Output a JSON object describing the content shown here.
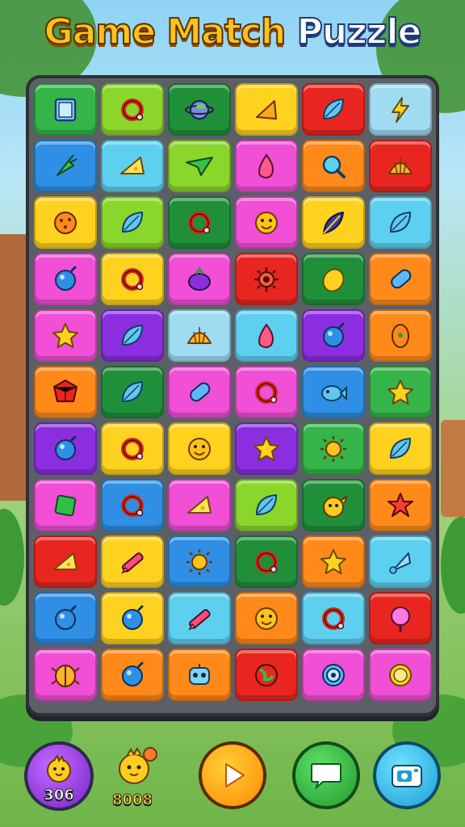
{
  "title": {
    "word1": "Game Match",
    "word2": "Puzzle"
  },
  "colors": {
    "green": "#34b449",
    "lime": "#8bd62a",
    "yellow": "#ffd21f",
    "red": "#e8261f",
    "sky": "#5ed0ef",
    "blue": "#2e8fe4",
    "pink": "#f04fd6",
    "orange": "#ff8a1a",
    "purple": "#8a2ee0",
    "paleblue": "#9fdcf2",
    "darkgreen": "#1f8f3a",
    "magenta": "#ee3fae"
  },
  "board": {
    "rows": [
      [
        {
          "bg": "green",
          "icon": "frame-icon"
        },
        {
          "bg": "lime",
          "icon": "ring-icon"
        },
        {
          "bg": "darkgreen",
          "icon": "planet-icon"
        },
        {
          "bg": "yellow",
          "icon": "wedge-icon"
        },
        {
          "bg": "red",
          "icon": "leaf-icon"
        },
        {
          "bg": "paleblue",
          "icon": "lightning-icon"
        }
      ],
      [
        {
          "bg": "blue",
          "icon": "carrot-icon"
        },
        {
          "bg": "sky",
          "icon": "cheese-icon"
        },
        {
          "bg": "lime",
          "icon": "plane-icon"
        },
        {
          "bg": "pink",
          "icon": "drop-icon"
        },
        {
          "bg": "orange",
          "icon": "magnifier-icon"
        },
        {
          "bg": "red",
          "icon": "shell-icon"
        }
      ],
      [
        {
          "bg": "yellow",
          "icon": "cookie-icon"
        },
        {
          "bg": "lime",
          "icon": "leaf-icon"
        },
        {
          "bg": "darkgreen",
          "icon": "ring-icon"
        },
        {
          "bg": "pink",
          "icon": "smiley-icon"
        },
        {
          "bg": "yellow",
          "icon": "feather-icon"
        },
        {
          "bg": "sky",
          "icon": "leaf-icon"
        }
      ],
      [
        {
          "bg": "pink",
          "icon": "orb-icon"
        },
        {
          "bg": "yellow",
          "icon": "ring-icon"
        },
        {
          "bg": "pink",
          "icon": "berry-icon"
        },
        {
          "bg": "red",
          "icon": "gear-icon"
        },
        {
          "bg": "darkgreen",
          "icon": "lemon-icon"
        },
        {
          "bg": "orange",
          "icon": "capsule-icon"
        }
      ],
      [
        {
          "bg": "pink",
          "icon": "star-icon"
        },
        {
          "bg": "purple",
          "icon": "leaf-icon"
        },
        {
          "bg": "paleblue",
          "icon": "shell-icon"
        },
        {
          "bg": "sky",
          "icon": "drop-icon"
        },
        {
          "bg": "purple",
          "icon": "orb-icon"
        },
        {
          "bg": "orange",
          "icon": "seed-icon"
        }
      ],
      [
        {
          "bg": "orange",
          "icon": "gem-icon"
        },
        {
          "bg": "darkgreen",
          "icon": "leaf-icon"
        },
        {
          "bg": "pink",
          "icon": "capsule-icon"
        },
        {
          "bg": "pink",
          "icon": "ring-icon"
        },
        {
          "bg": "blue",
          "icon": "fish-icon"
        },
        {
          "bg": "green",
          "icon": "star-icon"
        }
      ],
      [
        {
          "bg": "purple",
          "icon": "orb-icon"
        },
        {
          "bg": "yellow",
          "icon": "ring-icon"
        },
        {
          "bg": "yellow",
          "icon": "smiley-icon"
        },
        {
          "bg": "purple",
          "icon": "star-icon"
        },
        {
          "bg": "green",
          "icon": "sun-icon"
        },
        {
          "bg": "yellow",
          "icon": "leaf-icon"
        }
      ],
      [
        {
          "bg": "pink",
          "icon": "cube-icon"
        },
        {
          "bg": "blue",
          "icon": "ring-icon"
        },
        {
          "bg": "pink",
          "icon": "cheese-icon"
        },
        {
          "bg": "lime",
          "icon": "leaf-icon"
        },
        {
          "bg": "darkgreen",
          "icon": "chick-icon"
        },
        {
          "bg": "orange",
          "icon": "flower-icon"
        }
      ],
      [
        {
          "bg": "red",
          "icon": "cheese-icon"
        },
        {
          "bg": "yellow",
          "icon": "pencil-icon"
        },
        {
          "bg": "blue",
          "icon": "sun-icon"
        },
        {
          "bg": "darkgreen",
          "icon": "ring-icon"
        },
        {
          "bg": "orange",
          "icon": "star-icon"
        },
        {
          "bg": "sky",
          "icon": "cone-icon"
        }
      ],
      [
        {
          "bg": "blue",
          "icon": "orb-icon"
        },
        {
          "bg": "yellow",
          "icon": "orb-icon"
        },
        {
          "bg": "sky",
          "icon": "pencil-icon"
        },
        {
          "bg": "orange",
          "icon": "smiley-icon"
        },
        {
          "bg": "sky",
          "icon": "ring-icon"
        },
        {
          "bg": "red",
          "icon": "lollipop-icon"
        }
      ],
      [
        {
          "bg": "pink",
          "icon": "beetle-icon"
        },
        {
          "bg": "orange",
          "icon": "orb-icon"
        },
        {
          "bg": "orange",
          "icon": "robot-icon"
        },
        {
          "bg": "red",
          "icon": "globe-icon"
        },
        {
          "bg": "pink",
          "icon": "target-icon"
        },
        {
          "bg": "pink",
          "icon": "coin-icon"
        }
      ]
    ]
  },
  "hud": {
    "score1": "306",
    "score2": "8008",
    "play_icon": "play-icon",
    "chat_icon": "chat-icon",
    "camera_icon": "camera-icon"
  }
}
